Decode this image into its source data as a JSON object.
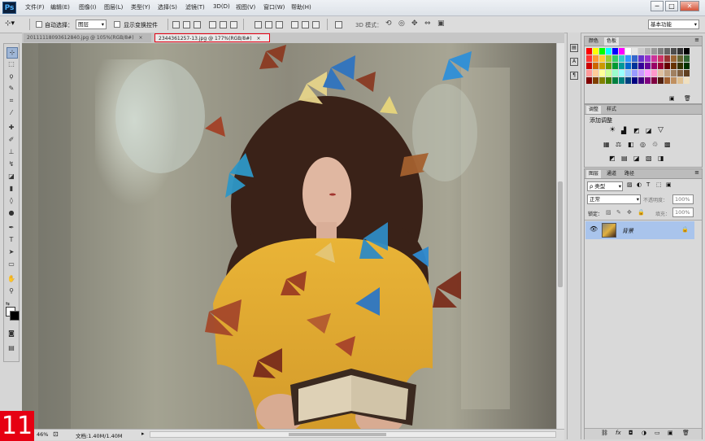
{
  "app": {
    "logo": "Ps"
  },
  "menu": [
    "文件(F)",
    "编辑(E)",
    "图像(I)",
    "图层(L)",
    "类型(Y)",
    "选择(S)",
    "滤镜(T)",
    "3D(D)",
    "视图(V)",
    "窗口(W)",
    "帮助(H)"
  ],
  "window_controls": {
    "minimize": "─",
    "restore": "□",
    "close": "✕"
  },
  "options_bar": {
    "auto_select_label": "自动选择：",
    "auto_select_value": "图层",
    "show_transform_label": "显示变换控件",
    "mode_3d_label": "3D 模式：",
    "workspace": "基本功能"
  },
  "tabs": [
    {
      "label": "20111118093612840.jpg @ 105%(RGB/8#)",
      "close": "×",
      "active": false
    },
    {
      "label": "2344361257-13.jpg @ 177%(RGB/8#)",
      "close": "×",
      "active": true
    }
  ],
  "status": {
    "zoom": "46%",
    "doc_label": "文档:1.40M/1.40M"
  },
  "swatches_panel": {
    "tabs": [
      "颜色",
      "色板"
    ],
    "active_tab": 1
  },
  "adjust_panel": {
    "tabs": [
      "调整",
      "样式"
    ],
    "title": "添加调整"
  },
  "layers_panel": {
    "tabs": [
      "图层",
      "通道",
      "路径"
    ],
    "filter_value": "ρ 类型",
    "blend_mode": "正常",
    "opacity_label": "不透明度：",
    "opacity_value": "100%",
    "lock_label": "锁定：",
    "fill_label": "填充：",
    "fill_value": "100%",
    "layer_name": "背景"
  },
  "badge": "11",
  "colors": {
    "accent_red": "#e60012",
    "layer_selected": "#a9c4ec",
    "photo_yellow": "#e8b634"
  }
}
